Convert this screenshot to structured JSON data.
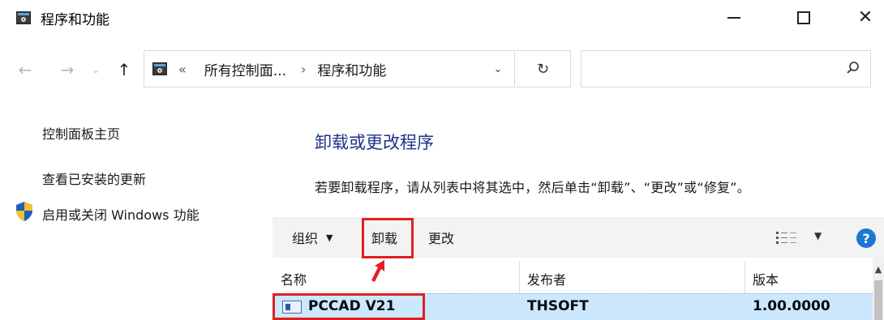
{
  "window": {
    "title": "程序和功能",
    "minimize_icon": "minimize-icon",
    "maximize_icon": "maximize-icon",
    "close_icon": "close-icon"
  },
  "nav": {
    "back_icon": "back-arrow-icon",
    "forward_icon": "forward-arrow-icon",
    "recent_icon": "chevron-down-icon",
    "up_icon": "up-arrow-icon",
    "address": {
      "overflow": "«",
      "crumbs": [
        "所有控制面...",
        "程序和功能"
      ],
      "separator": "›"
    },
    "refresh_icon": "refresh-icon",
    "search_placeholder": "",
    "search_icon": "search-icon"
  },
  "sidebar": {
    "items": [
      {
        "label": "控制面板主页"
      },
      {
        "label": "查看已安装的更新"
      },
      {
        "label": "启用或关闭 Windows 功能",
        "icon": "shield-icon"
      }
    ]
  },
  "main": {
    "title": "卸载或更改程序",
    "description": "若要卸载程序，请从列表中将其选中，然后单击“卸载”、“更改”或“修复”。"
  },
  "toolbar": {
    "organize_label": "组织",
    "uninstall_label": "卸载",
    "change_label": "更改",
    "view_icon": "view-options-icon",
    "help_icon": "help-icon",
    "help_glyph": "?"
  },
  "table": {
    "columns": [
      "名称",
      "发布者",
      "版本"
    ],
    "rows": [
      {
        "name": "PCCAD V21",
        "publisher": "THSOFT",
        "version": "1.00.0000",
        "selected": true
      }
    ]
  },
  "colors": {
    "title_blue": "#1e3287",
    "highlight_red": "#e02020",
    "selection_blue": "#cce8ff",
    "toolbar_bg": "#f3f3f3"
  }
}
